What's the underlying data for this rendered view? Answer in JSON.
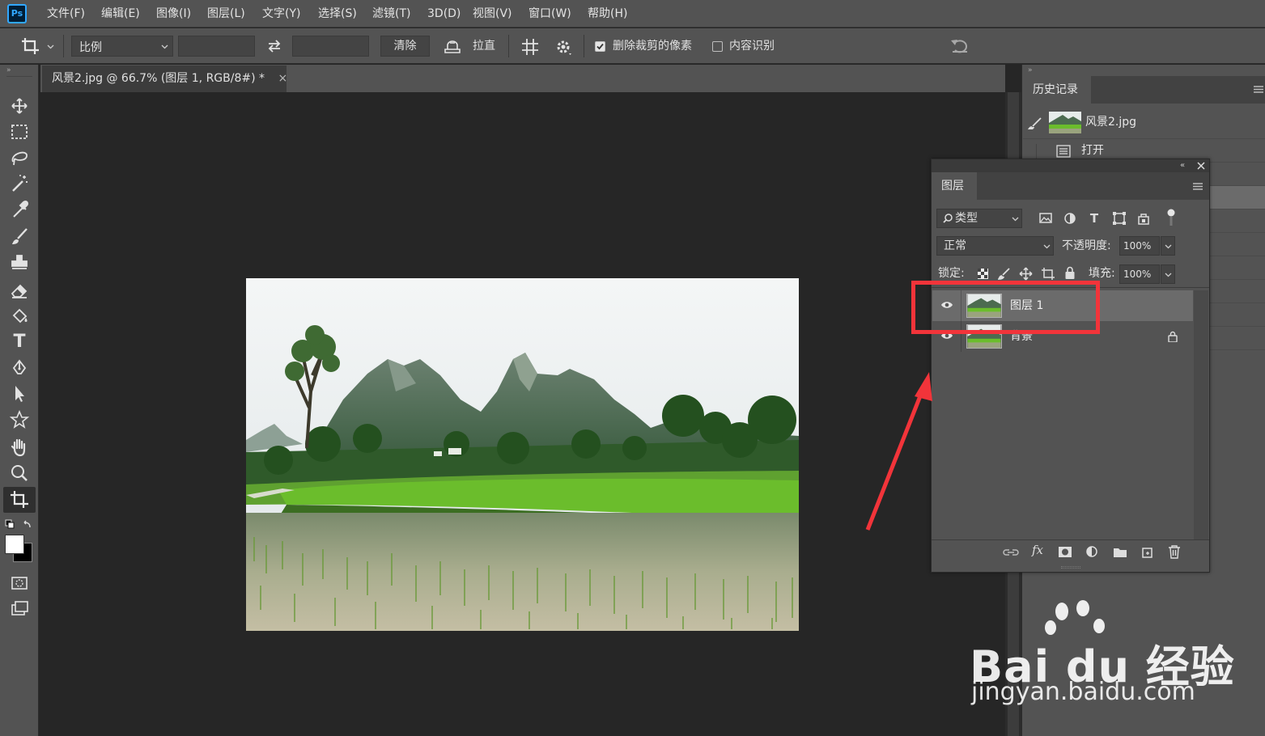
{
  "app": {
    "logo": "Ps"
  },
  "menu": [
    "文件(F)",
    "编辑(E)",
    "图像(I)",
    "图层(L)",
    "文字(Y)",
    "选择(S)",
    "滤镜(T)",
    "3D(D)",
    "视图(V)",
    "窗口(W)",
    "帮助(H)"
  ],
  "options": {
    "ratio_label": "比例",
    "width_value": "",
    "height_value": "",
    "clear_label": "清除",
    "straighten_label": "拉直",
    "delete_cropped_label": "删除裁剪的像素",
    "delete_cropped_checked": true,
    "content_aware_label": "内容识别",
    "content_aware_checked": false
  },
  "document": {
    "tab_title": "风景2.jpg @ 66.7% (图层 1, RGB/8#) *",
    "close_glyph": "×"
  },
  "history": {
    "tab": "历史记录",
    "snapshot": "风景2.jpg",
    "steps": [
      "打开"
    ]
  },
  "layers_panel": {
    "tab": "图层",
    "filter_label": "类型",
    "blend_mode": "正常",
    "opacity_label": "不透明度:",
    "opacity_value": "100%",
    "lock_label": "锁定:",
    "fill_label": "填充:",
    "fill_value": "100%",
    "layers": [
      {
        "name": "图层 1",
        "selected": true,
        "locked": false
      },
      {
        "name": "背景",
        "selected": false,
        "locked": true
      }
    ]
  },
  "annotation": {
    "color": "#f2343a"
  },
  "watermark": {
    "logo_text": "Bai du 经验",
    "url": "jingyan.baidu.com"
  }
}
